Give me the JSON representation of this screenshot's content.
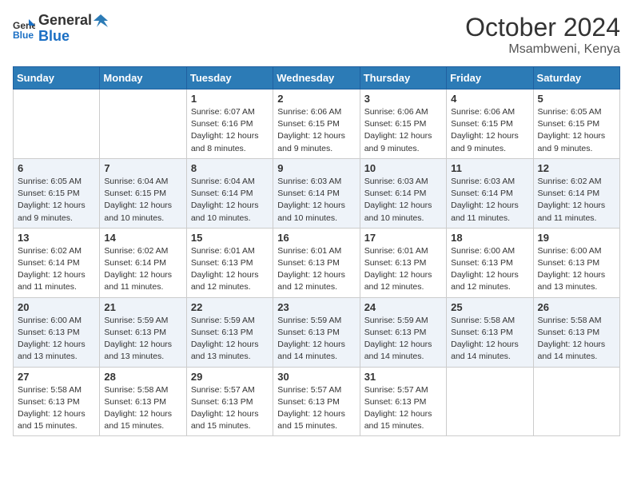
{
  "header": {
    "logo_general": "General",
    "logo_blue": "Blue",
    "month_year": "October 2024",
    "location": "Msambweni, Kenya"
  },
  "days_of_week": [
    "Sunday",
    "Monday",
    "Tuesday",
    "Wednesday",
    "Thursday",
    "Friday",
    "Saturday"
  ],
  "weeks": [
    [
      null,
      null,
      {
        "day": 1,
        "sunrise": "6:07 AM",
        "sunset": "6:16 PM",
        "daylight": "12 hours and 8 minutes."
      },
      {
        "day": 2,
        "sunrise": "6:06 AM",
        "sunset": "6:15 PM",
        "daylight": "12 hours and 9 minutes."
      },
      {
        "day": 3,
        "sunrise": "6:06 AM",
        "sunset": "6:15 PM",
        "daylight": "12 hours and 9 minutes."
      },
      {
        "day": 4,
        "sunrise": "6:06 AM",
        "sunset": "6:15 PM",
        "daylight": "12 hours and 9 minutes."
      },
      {
        "day": 5,
        "sunrise": "6:05 AM",
        "sunset": "6:15 PM",
        "daylight": "12 hours and 9 minutes."
      }
    ],
    [
      {
        "day": 6,
        "sunrise": "6:05 AM",
        "sunset": "6:15 PM",
        "daylight": "12 hours and 9 minutes."
      },
      {
        "day": 7,
        "sunrise": "6:04 AM",
        "sunset": "6:15 PM",
        "daylight": "12 hours and 10 minutes."
      },
      {
        "day": 8,
        "sunrise": "6:04 AM",
        "sunset": "6:14 PM",
        "daylight": "12 hours and 10 minutes."
      },
      {
        "day": 9,
        "sunrise": "6:03 AM",
        "sunset": "6:14 PM",
        "daylight": "12 hours and 10 minutes."
      },
      {
        "day": 10,
        "sunrise": "6:03 AM",
        "sunset": "6:14 PM",
        "daylight": "12 hours and 10 minutes."
      },
      {
        "day": 11,
        "sunrise": "6:03 AM",
        "sunset": "6:14 PM",
        "daylight": "12 hours and 11 minutes."
      },
      {
        "day": 12,
        "sunrise": "6:02 AM",
        "sunset": "6:14 PM",
        "daylight": "12 hours and 11 minutes."
      }
    ],
    [
      {
        "day": 13,
        "sunrise": "6:02 AM",
        "sunset": "6:14 PM",
        "daylight": "12 hours and 11 minutes."
      },
      {
        "day": 14,
        "sunrise": "6:02 AM",
        "sunset": "6:14 PM",
        "daylight": "12 hours and 11 minutes."
      },
      {
        "day": 15,
        "sunrise": "6:01 AM",
        "sunset": "6:13 PM",
        "daylight": "12 hours and 12 minutes."
      },
      {
        "day": 16,
        "sunrise": "6:01 AM",
        "sunset": "6:13 PM",
        "daylight": "12 hours and 12 minutes."
      },
      {
        "day": 17,
        "sunrise": "6:01 AM",
        "sunset": "6:13 PM",
        "daylight": "12 hours and 12 minutes."
      },
      {
        "day": 18,
        "sunrise": "6:00 AM",
        "sunset": "6:13 PM",
        "daylight": "12 hours and 12 minutes."
      },
      {
        "day": 19,
        "sunrise": "6:00 AM",
        "sunset": "6:13 PM",
        "daylight": "12 hours and 13 minutes."
      }
    ],
    [
      {
        "day": 20,
        "sunrise": "6:00 AM",
        "sunset": "6:13 PM",
        "daylight": "12 hours and 13 minutes."
      },
      {
        "day": 21,
        "sunrise": "5:59 AM",
        "sunset": "6:13 PM",
        "daylight": "12 hours and 13 minutes."
      },
      {
        "day": 22,
        "sunrise": "5:59 AM",
        "sunset": "6:13 PM",
        "daylight": "12 hours and 13 minutes."
      },
      {
        "day": 23,
        "sunrise": "5:59 AM",
        "sunset": "6:13 PM",
        "daylight": "12 hours and 14 minutes."
      },
      {
        "day": 24,
        "sunrise": "5:59 AM",
        "sunset": "6:13 PM",
        "daylight": "12 hours and 14 minutes."
      },
      {
        "day": 25,
        "sunrise": "5:58 AM",
        "sunset": "6:13 PM",
        "daylight": "12 hours and 14 minutes."
      },
      {
        "day": 26,
        "sunrise": "5:58 AM",
        "sunset": "6:13 PM",
        "daylight": "12 hours and 14 minutes."
      }
    ],
    [
      {
        "day": 27,
        "sunrise": "5:58 AM",
        "sunset": "6:13 PM",
        "daylight": "12 hours and 15 minutes."
      },
      {
        "day": 28,
        "sunrise": "5:58 AM",
        "sunset": "6:13 PM",
        "daylight": "12 hours and 15 minutes."
      },
      {
        "day": 29,
        "sunrise": "5:57 AM",
        "sunset": "6:13 PM",
        "daylight": "12 hours and 15 minutes."
      },
      {
        "day": 30,
        "sunrise": "5:57 AM",
        "sunset": "6:13 PM",
        "daylight": "12 hours and 15 minutes."
      },
      {
        "day": 31,
        "sunrise": "5:57 AM",
        "sunset": "6:13 PM",
        "daylight": "12 hours and 15 minutes."
      },
      null,
      null
    ]
  ]
}
